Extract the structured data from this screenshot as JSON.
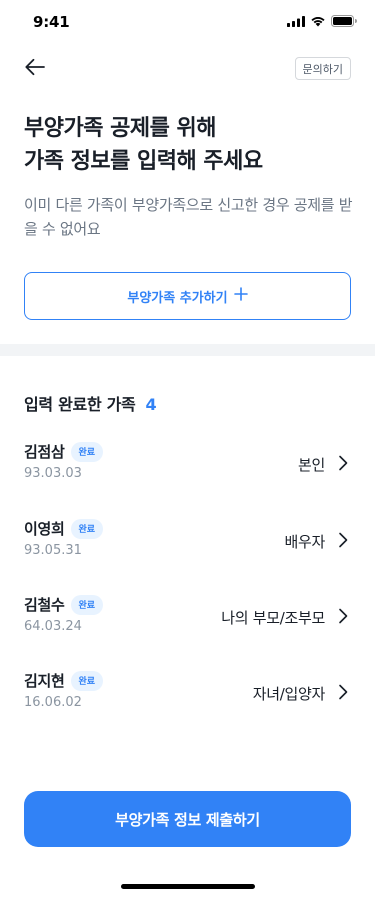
{
  "status_bar": {
    "time": "9:41",
    "icons": [
      "cellular-signal-icon",
      "wifi-icon",
      "battery-icon"
    ]
  },
  "nav": {
    "back_icon": "arrow-left-icon",
    "inquiry_label": "문의하기"
  },
  "header": {
    "title_line1": "부양가족 공제를 위해",
    "title_line2": "가족 정보를 입력해 주세요",
    "subtitle": "이미 다른 가족이 부양가족으로 신고한 경우 공제를 받을 수 없어요"
  },
  "add_button": {
    "label": "부양가족 추가하기",
    "icon": "plus-icon"
  },
  "family_section": {
    "title": "입력 완료한 가족",
    "count": "4",
    "members": [
      {
        "name": "김점삼",
        "badge": "완료",
        "date": "93.03.03",
        "relation": "본인"
      },
      {
        "name": "이영희",
        "badge": "완료",
        "date": "93.05.31",
        "relation": "배우자"
      },
      {
        "name": "김철수",
        "badge": "완료",
        "date": "64.03.24",
        "relation": "나의 부모/조부모"
      },
      {
        "name": "김지현",
        "badge": "완료",
        "date": "16.06.02",
        "relation": "자녀/입양자"
      }
    ]
  },
  "submit_button": {
    "label": "부양가족 정보 제출하기"
  },
  "colors": {
    "accent": "#3182f6",
    "badge_bg": "#e8f3ff",
    "text_primary": "#191f28",
    "text_secondary": "#6b7684",
    "text_tertiary": "#8b95a1",
    "divider": "#f2f4f6"
  }
}
